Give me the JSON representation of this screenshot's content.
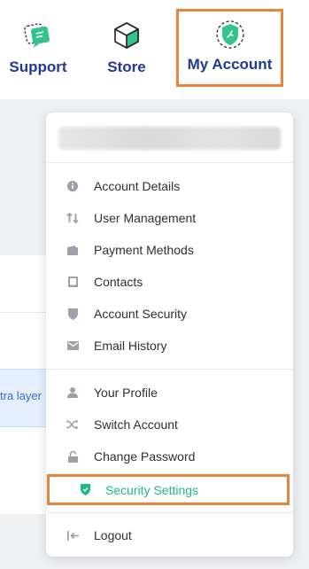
{
  "topnav": {
    "support_label": "Support",
    "store_label": "Store",
    "account_label": "My Account"
  },
  "background": {
    "banner_text": "tra layer"
  },
  "menu": {
    "group1": [
      {
        "label": "Account Details",
        "icon": "info-icon"
      },
      {
        "label": "User Management",
        "icon": "sort-arrows-icon"
      },
      {
        "label": "Payment Methods",
        "icon": "wallet-icon"
      },
      {
        "label": "Contacts",
        "icon": "contact-book-icon"
      },
      {
        "label": "Account Security",
        "icon": "shield-icon"
      },
      {
        "label": "Email History",
        "icon": "envelope-icon"
      }
    ],
    "group2": [
      {
        "label": "Your Profile",
        "icon": "person-icon"
      },
      {
        "label": "Switch Account",
        "icon": "shuffle-icon"
      },
      {
        "label": "Change Password",
        "icon": "lock-icon"
      },
      {
        "label": "Security Settings",
        "icon": "shield-check-icon"
      }
    ],
    "logout_label": "Logout"
  },
  "colors": {
    "brand_blue": "#1f3a93",
    "accent_green": "#1eb980",
    "highlight_orange": "#e8853d",
    "icon_gray": "#9aa1ab"
  }
}
